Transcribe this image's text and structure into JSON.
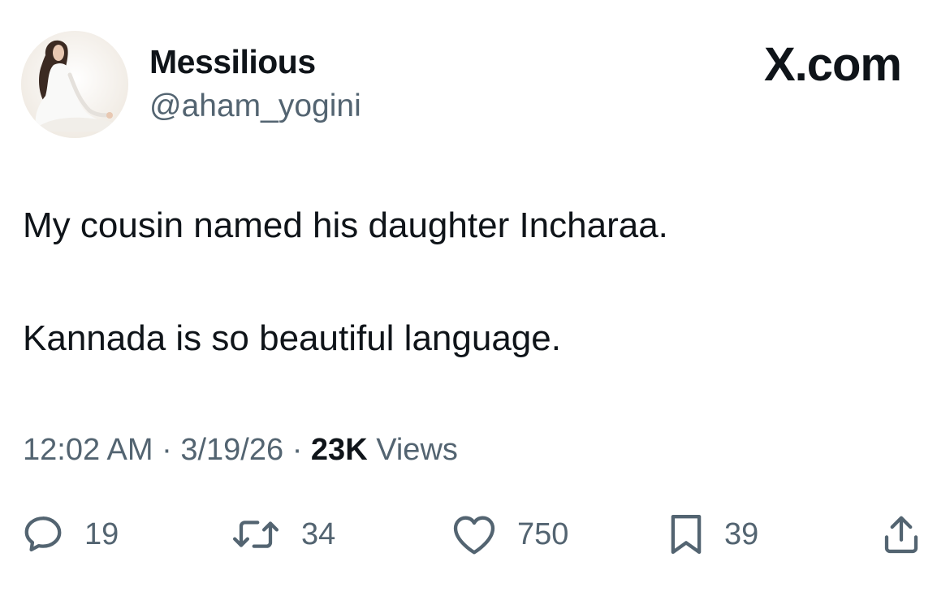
{
  "author": {
    "display_name": "Messilious",
    "handle": "@aham_yogini"
  },
  "site_label": "X.com",
  "post": {
    "lines": [
      "My cousin named his daughter Incharaa.",
      "Kannada is so beautiful language."
    ]
  },
  "meta": {
    "time": "12:02 AM",
    "separator": "·",
    "date": "3/19/26",
    "views_count": "23K",
    "views_label": "Views"
  },
  "actions": {
    "replies": {
      "icon": "reply-icon",
      "count": "19"
    },
    "reposts": {
      "icon": "repost-icon",
      "count": "34"
    },
    "likes": {
      "icon": "heart-icon",
      "count": "750"
    },
    "bookmarks": {
      "icon": "bookmark-icon",
      "count": "39"
    },
    "share": {
      "icon": "share-icon"
    }
  },
  "colors": {
    "primary_text": "#0f1419",
    "secondary_text": "#536471",
    "background": "#ffffff"
  }
}
